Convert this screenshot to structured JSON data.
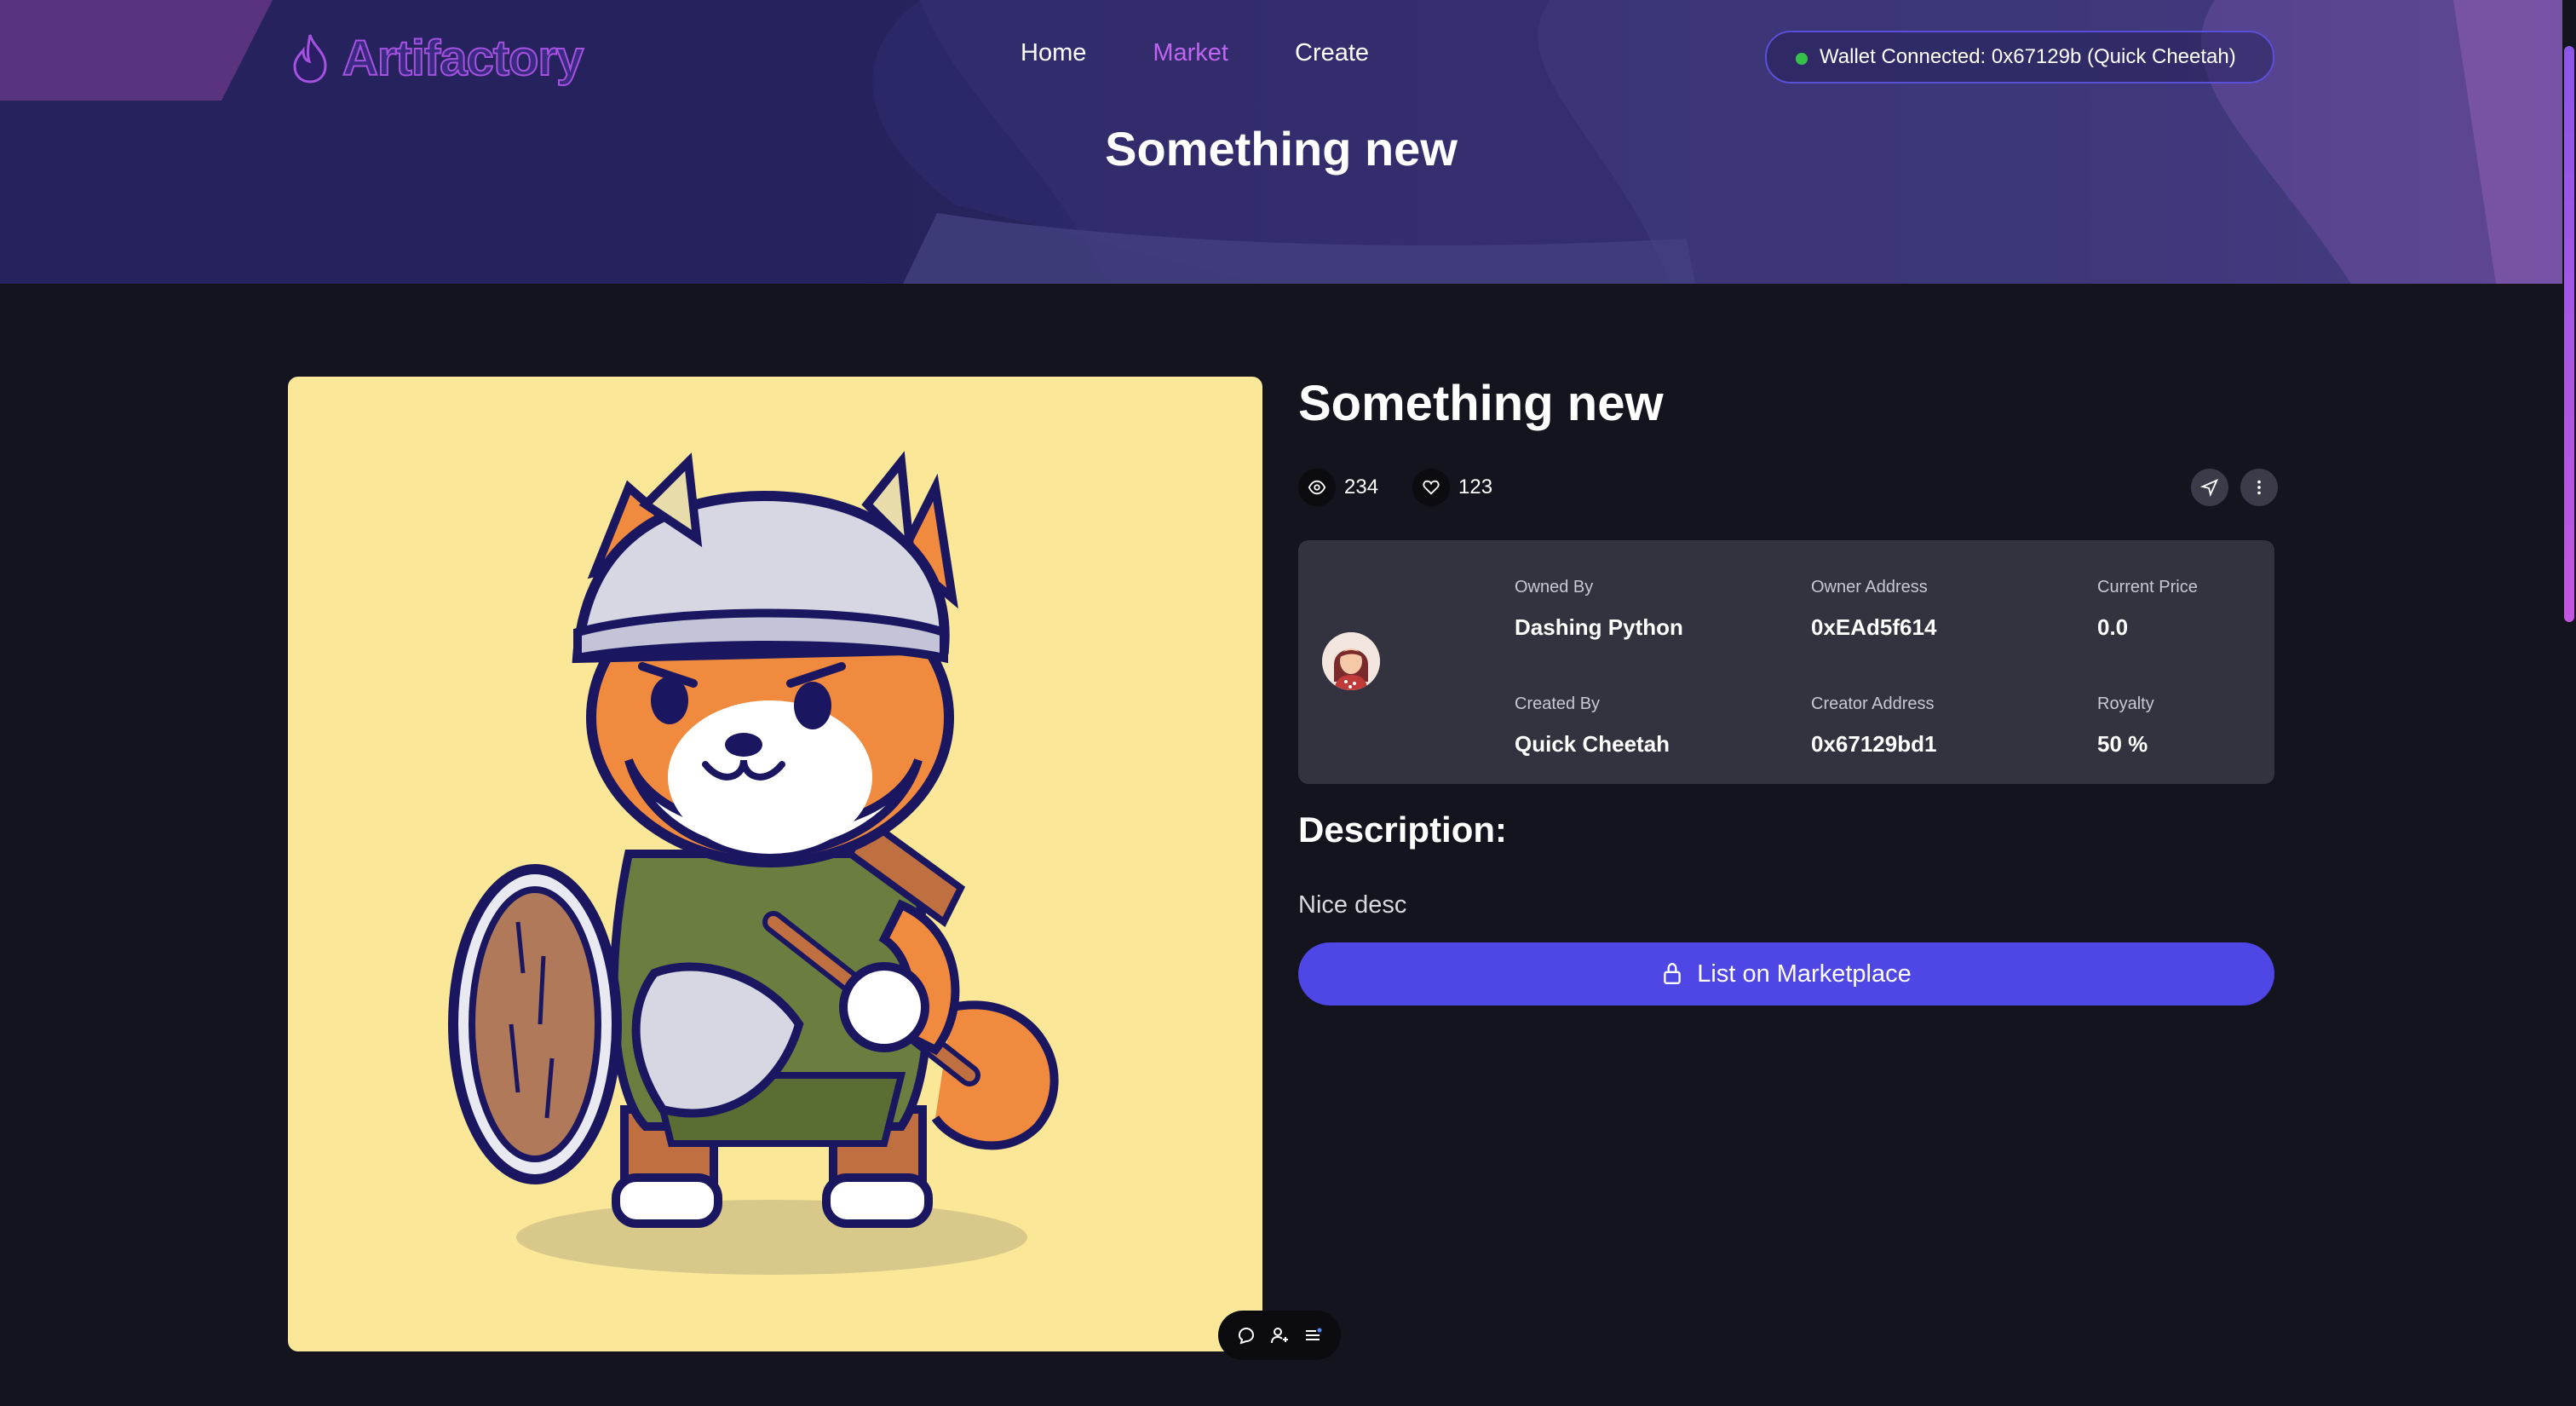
{
  "header": {
    "logo_text": "Artifactory",
    "nav": [
      {
        "label": "Home",
        "active": false
      },
      {
        "label": "Market",
        "active": true
      },
      {
        "label": "Create",
        "active": false
      }
    ],
    "wallet_status": "Wallet Connected: 0x67129b (Quick Cheetah)",
    "page_title": "Something new"
  },
  "item": {
    "title": "Something new",
    "views": "234",
    "likes": "123",
    "owned_by_label": "Owned By",
    "owned_by": "Dashing Python",
    "owner_address_label": "Owner Address",
    "owner_address": "0xEAd5f614",
    "current_price_label": "Current Price",
    "current_price": "0.0",
    "created_by_label": "Created By",
    "created_by": "Quick Cheetah",
    "creator_address_label": "Creator Address",
    "creator_address": "0x67129bd1",
    "royalty_label": "Royalty",
    "royalty": "50 %",
    "description_heading": "Description:",
    "description": "Nice desc",
    "list_button": "List on Marketplace"
  },
  "icons": {
    "logo": "flame-icon",
    "views": "eye-icon",
    "likes": "heart-icon",
    "share": "send-icon",
    "more": "more-vertical-icon",
    "list": "lock-icon",
    "toolbar": [
      "chat-bubble-icon",
      "add-user-icon",
      "list-menu-icon"
    ]
  },
  "colors": {
    "accent": "#4e46e5",
    "nav_active": "#c264f2",
    "wallet_dot": "#36c24a",
    "background": "#14141f",
    "card": "#33333f",
    "artwork_bg": "#fae898"
  }
}
